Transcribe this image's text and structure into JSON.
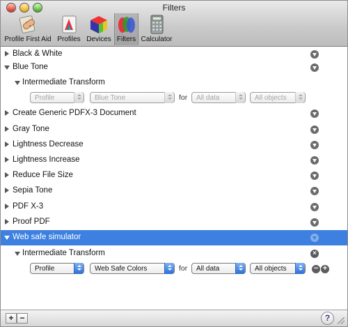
{
  "window": {
    "title": "Filters"
  },
  "toolbar": [
    {
      "label": "Profile First Aid",
      "icon": "profile-first-aid-icon"
    },
    {
      "label": "Profiles",
      "icon": "profiles-icon"
    },
    {
      "label": "Devices",
      "icon": "devices-icon"
    },
    {
      "label": "Filters",
      "icon": "filters-icon",
      "selected": true
    },
    {
      "label": "Calculator",
      "icon": "calculator-icon"
    }
  ],
  "filters": [
    {
      "label": "Black & White",
      "expanded": false
    },
    {
      "label": "Blue Tone",
      "expanded": true
    },
    {
      "label": "Create Generic PDFX-3 Document",
      "expanded": false
    },
    {
      "label": "Gray Tone",
      "expanded": false
    },
    {
      "label": "Lightness Decrease",
      "expanded": false
    },
    {
      "label": "Lightness Increase",
      "expanded": false
    },
    {
      "label": "Reduce File Size",
      "expanded": false
    },
    {
      "label": "Sepia Tone",
      "expanded": false
    },
    {
      "label": "PDF X-3",
      "expanded": false
    },
    {
      "label": "Proof PDF",
      "expanded": false
    },
    {
      "label": "Web safe simulator",
      "expanded": true,
      "selected": true
    }
  ],
  "blue_tone_component": {
    "label": "Intermediate Transform",
    "type_popup": "Profile",
    "profile_popup": "Blue Tone",
    "for_label": "for",
    "data_popup": "All data",
    "objects_popup": "All objects"
  },
  "web_safe_component": {
    "label": "Intermediate Transform",
    "type_popup": "Profile",
    "profile_popup": "Web Safe Colors",
    "for_label": "for",
    "data_popup": "All data",
    "objects_popup": "All objects",
    "remove_symbol": "−",
    "add_symbol": "+",
    "delete_symbol": "×"
  },
  "bottombar": {
    "add_label": "+",
    "remove_label": "−",
    "help_label": "?"
  },
  "colors": {
    "selection": "#3d80df",
    "accent_popup": "#2a6fd6"
  }
}
